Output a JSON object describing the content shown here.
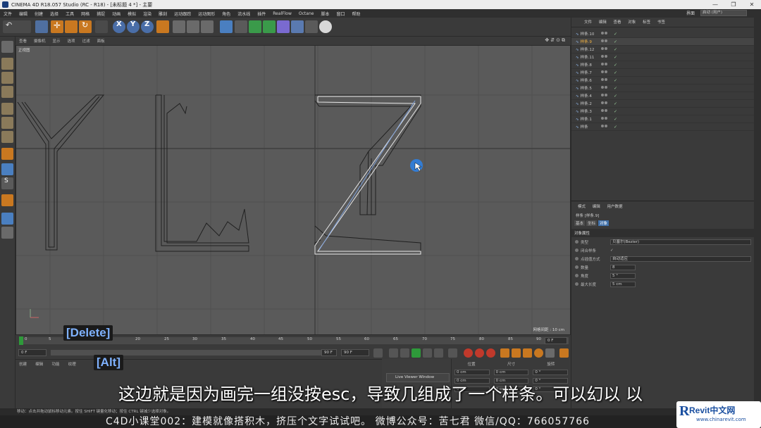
{
  "window": {
    "title": "CINEMA 4D R18.057 Studio (RC - R18) - [未标题 4 *] - 主要"
  },
  "menu": [
    "文件",
    "编辑",
    "创建",
    "选择",
    "工具",
    "网格",
    "捕捉",
    "动画",
    "模拟",
    "渲染",
    "雕刻",
    "运动跟踪",
    "运动图形",
    "角色",
    "流水线",
    "插件",
    "RealFlow",
    "Octane",
    "脚本",
    "窗口",
    "帮助"
  ],
  "layout": {
    "label": "界面",
    "value": "启动 (用户)"
  },
  "viewport": {
    "menu": [
      "查看",
      "摄像机",
      "显示",
      "选项",
      "过滤",
      "面板"
    ],
    "label": "正视图",
    "grid_info": "网格间距 : 10 cm"
  },
  "timeline": {
    "ticks": [
      "0",
      "5",
      "10",
      "15",
      "20",
      "25",
      "30",
      "35",
      "40",
      "45",
      "50",
      "55",
      "60",
      "65",
      "70",
      "75",
      "80",
      "85",
      "90"
    ],
    "end_frame": "0 F"
  },
  "playback": {
    "start": "0 F",
    "end_a": "90 F",
    "end_b": "90 F"
  },
  "material": {
    "menu": [
      "创建",
      "编辑",
      "功能",
      "纹理"
    ]
  },
  "coords": {
    "headers": [
      "位置",
      "尺寸",
      "旋转"
    ],
    "rows": [
      [
        "0 cm",
        "0 cm",
        "0 °"
      ],
      [
        "0 cm",
        "0 cm",
        "0 °"
      ],
      [
        "0 cm",
        "0 cm",
        "0 °"
      ]
    ]
  },
  "live_viewer": "Live Viewer Window",
  "status": "移动：点击并拖动鼠标移动元素。按住 SHIFT 键量化移动；按住 CTRL 键减少选择对象。",
  "objects": {
    "menu": [
      "文件",
      "编辑",
      "查看",
      "对象",
      "标签",
      "书签"
    ],
    "items": [
      "样条.10",
      "样条.9",
      "样条.12",
      "样条.11",
      "样条.8",
      "样条.7",
      "样条.6",
      "样条.5",
      "样条.4",
      "样条.2",
      "样条.3",
      "样条.1",
      "样条"
    ],
    "selected_index": 1
  },
  "attributes": {
    "menu": [
      "模式",
      "编辑",
      "用户数据"
    ],
    "object_name": "样条 [样条.9]",
    "tabs": [
      "基本",
      "坐标",
      "对象"
    ],
    "active_tab": 2,
    "section": "对象属性",
    "rows": [
      {
        "label": "类型",
        "value": "贝塞尔(Bezier)"
      },
      {
        "label": "闭合样条",
        "value": "✓"
      },
      {
        "label": "点插值方式",
        "value": "自动适应"
      },
      {
        "label": "数量",
        "value": "8"
      },
      {
        "label": "角度",
        "value": "5 °"
      },
      {
        "label": "最大长度",
        "value": "5 cm"
      }
    ]
  },
  "keys": {
    "delete": "[Delete]",
    "alt": "[Alt]"
  },
  "subtitle": "这边就是因为画完一组没按esc，导致几组成了一个样条。可以幻以 以",
  "footer": "C4D小课堂002：建模就像搭积木，挤压个文字试试吧。   微博公众号：苦七君   微信/QQ：766057766",
  "watermark": {
    "brand": "Revit中文网",
    "url": "www.chinarevit.com"
  },
  "colors": {
    "accent": "#3f6fa8",
    "selected": "#f0b040",
    "viewport": "#5a5a5a"
  }
}
